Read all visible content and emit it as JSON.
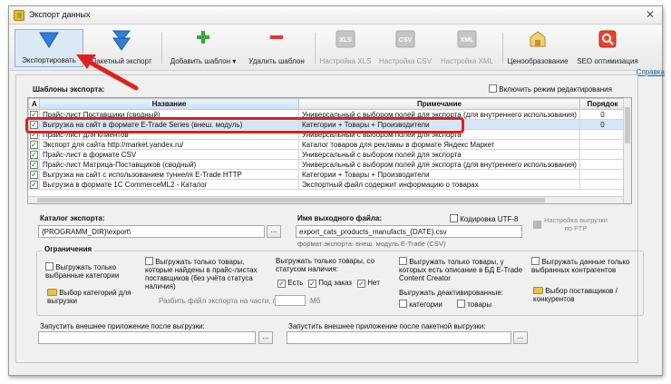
{
  "window": {
    "title": "Экспорт данных",
    "close_glyph": "✕"
  },
  "toolbar": {
    "export": "Экспортировать",
    "batch_export": "Пакетный экспорт",
    "add_template": "Добавить шаблон",
    "add_template_caret": "▾",
    "delete_template": "Удалить шаблон",
    "xls_settings": "Настройка XLS",
    "csv_settings": "Настройка CSV",
    "xml_settings": "Настройка XML",
    "pricing": "Ценообразование",
    "seo": "SEO оптимизация",
    "xls_icon": "XLS",
    "csv_icon": "CSV",
    "xml_icon": "XML"
  },
  "help_link": "Справка",
  "templates": {
    "title": "Шаблоны экспорта:",
    "edit_mode": "Включить режим редактирования",
    "headers": {
      "a": "А",
      "name": "Название",
      "note": "Примечание",
      "order": "Порядок"
    },
    "rows": [
      {
        "checked": "✓",
        "name": "Прайс-лист Поставщики (сводный)",
        "note": "Универсальный с выбором полей для экспорта (для внутреннего использования)",
        "order": "0"
      },
      {
        "checked": "✓",
        "name": "Выгрузка на сайт в формате E-Trade Series (внеш. модуль)",
        "note": "Категории + Товары + Производители",
        "order": "0"
      },
      {
        "checked": "✓",
        "name": "Прайс-лист для клиентов",
        "note": "Универсальный с выбором полей для экспорта",
        "order": ""
      },
      {
        "checked": "✓",
        "name": "Экспорт для сайта http://market.yandex.ru/",
        "note": "Каталог товаров для рекламы в формате Яндекс Маркет",
        "order": ""
      },
      {
        "checked": "✓",
        "name": "Прайс-лист в формате CSV",
        "note": "Универсальный с выбором полей для экспорта",
        "order": ""
      },
      {
        "checked": "✓",
        "name": "Прайс-лист Матрица-Поставщиков (сводный)",
        "note": "Универсальный с выбором полей для экспорта (для внутреннего использования)",
        "order": ""
      },
      {
        "checked": "✓",
        "name": "Выгрузка на сайт с использованием туннеля E-Trade HTTP",
        "note": "Категории + Товары + Производители",
        "order": ""
      },
      {
        "checked": "✓",
        "name": "Выгрузка в формате 1С CommerceML2 - Каталог",
        "note": "Экспортный файл содержит информацию о товарах",
        "order": ""
      }
    ]
  },
  "catalog": {
    "label": "Каталог экспорта:",
    "value": "{PROGRAMM_DIR}\\export\\",
    "browse": "..."
  },
  "output": {
    "label": "Имя выходного файла:",
    "value": "export_cats_products_manufacts_{DATE}.csv",
    "encoding": "Кодировка UTF-8",
    "format_note": "формат экспорта: внеш. модуль E-Trade (CSV)",
    "ftp_button": "Настройка выгрузки по FTP"
  },
  "restrictions": {
    "title": "Ограничения",
    "selected_categories": "Выгружать только выбранные категории",
    "choose_categories": "Выбор категорий для выгрузки",
    "found_in_pricelists": "Выгружать только товары, которые найдены в прайс-листах поставщиков (без учёта статуса наличия)",
    "split_label": "Разбить файл экспорта на части, по:",
    "split_unit": "Мб",
    "stock_status_label": "Выгружать только товары, со статусом наличия:",
    "status_yes": "Есть",
    "status_order": "Под заказ",
    "status_no": "Нет",
    "with_description": "Выгружать только товары, у которых есть описание в БД E-Trade Content Creator",
    "deactivated_label": "Выгружать деактивированные:",
    "deact_categories": "категории",
    "deact_products": "товары",
    "selected_contractors": "Выгружать данные только выбранных контрагентов",
    "choose_suppliers": "Выбор поставщиков / конкурентов"
  },
  "run_after": {
    "label": "Запустить внешнее приложение после выгрузки:",
    "browse": "..."
  },
  "run_after_batch": {
    "label": "Запустить внешнее приложение после пакетной выгрузки:",
    "browse": "..."
  }
}
